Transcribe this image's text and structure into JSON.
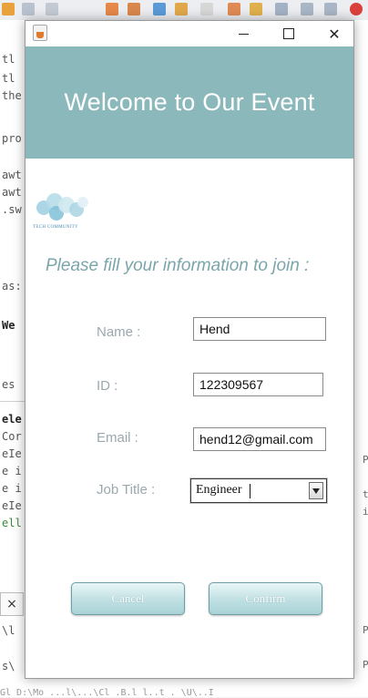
{
  "window": {
    "minimize_glyph": "—",
    "maximize_glyph": "☐",
    "close_glyph": "✕"
  },
  "header": {
    "title": "Welcome to Our Event"
  },
  "logo": {
    "text": "TECH COMMUNITY",
    "icon": "tech-community-logo"
  },
  "form": {
    "prompt": "Please fill your information to join :",
    "name_label": "Name :",
    "name_value": "Hend",
    "id_label": "ID :",
    "id_value": "122309567",
    "email_label": "Email :",
    "email_value": "hend12@gmail.com",
    "job_label": "Job Title :",
    "job_value": "Engineer"
  },
  "buttons": {
    "cancel": "Cancel",
    "confirm": "Confirm"
  },
  "ide": {
    "left_code": [
      "tl",
      "tl",
      "the",
      "pro",
      "awt",
      "awt",
      ".sw",
      "as:",
      "We",
      "es",
      "ele",
      "Cor",
      "eIe",
      "e i",
      "e i",
      "eIe",
      "ell",
      "\\l",
      "s\\"
    ],
    "right_code": [
      "P",
      "t",
      "i",
      "P",
      "P"
    ],
    "bottom_tab": "×",
    "bottom_line": "Gl     D:\\Mo   ...l\\...\\Cl   .B.l   l..t   .   \\U\\..I"
  },
  "colors": {
    "header_bg": "#8bb9bb",
    "accent_text": "#7aa6ab",
    "button_gradient_mid": "#bfe0e3"
  }
}
